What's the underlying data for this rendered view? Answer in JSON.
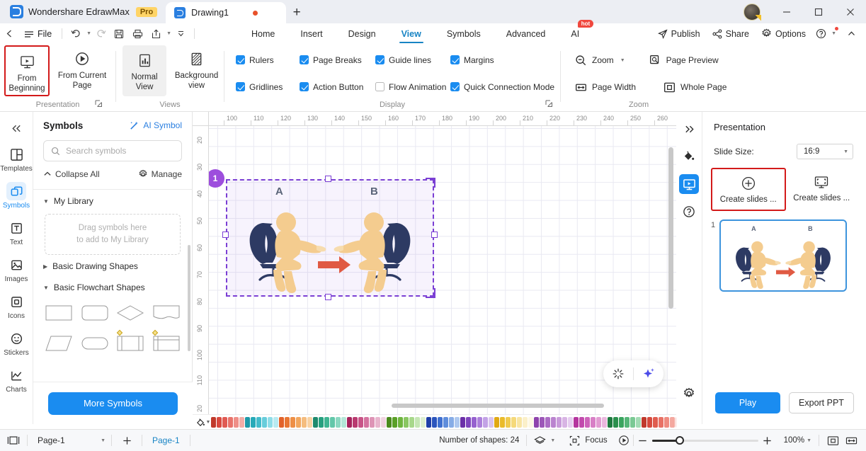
{
  "titlebar": {
    "brand": "Wondershare EdrawMax",
    "pro_badge": "Pro",
    "document_tab": "Drawing1",
    "new_tab_icon": "plus-icon",
    "minimize_icon": "minimize-icon",
    "maximize_icon": "maximize-icon",
    "close_icon": "close-icon"
  },
  "quick_access": {
    "back_icon": "chevron-left-icon",
    "file_label": "File",
    "undo_icon": "undo-icon",
    "redo_icon": "redo-icon",
    "save_icon": "save-icon",
    "print_icon": "print-icon",
    "export_icon": "export-icon",
    "more_icon": "chevron-down-icon"
  },
  "ribbon_tabs": [
    {
      "label": "Home",
      "active": false
    },
    {
      "label": "Insert",
      "active": false
    },
    {
      "label": "Design",
      "active": false
    },
    {
      "label": "View",
      "active": true
    },
    {
      "label": "Symbols",
      "active": false
    },
    {
      "label": "Advanced",
      "active": false
    },
    {
      "label": "AI",
      "active": false,
      "badge": "hot"
    }
  ],
  "menu_right": [
    {
      "label": "Publish",
      "icon": "send-icon"
    },
    {
      "label": "Share",
      "icon": "share-nodes-icon"
    },
    {
      "label": "Options",
      "icon": "gear-icon"
    },
    {
      "label": "",
      "icon": "help-circle-icon"
    },
    {
      "label": "",
      "icon": "chevron-up-icon"
    }
  ],
  "ribbon": {
    "presentation_group": {
      "label": "Presentation",
      "buttons": [
        {
          "label": "From Beginning",
          "icon": "present-screen-icon",
          "highlighted": true
        },
        {
          "label": "From Current Page",
          "icon": "play-circle-icon",
          "highlighted": false
        }
      ]
    },
    "views_group": {
      "label": "Views",
      "buttons": [
        {
          "label": "Normal View",
          "icon": "normal-view-icon",
          "selected": true
        },
        {
          "label": "Background view",
          "icon": "background-view-icon",
          "selected": false
        }
      ]
    },
    "display_group": {
      "label": "Display",
      "checkboxes": [
        {
          "label": "Rulers",
          "checked": true
        },
        {
          "label": "Page Breaks",
          "checked": true
        },
        {
          "label": "Guide lines",
          "checked": true
        },
        {
          "label": "Margins",
          "checked": true
        },
        {
          "label": "Gridlines",
          "checked": true
        },
        {
          "label": "Action Button",
          "checked": true
        },
        {
          "label": "Flow Animation",
          "checked": false
        },
        {
          "label": "Quick Connection Mode",
          "checked": true
        }
      ]
    },
    "zoom_group": {
      "label": "Zoom",
      "buttons": [
        {
          "label": "Zoom",
          "icon": "zoom-out-icon",
          "dropdown": true
        },
        {
          "label": "Page Preview",
          "icon": "page-preview-icon",
          "dropdown": false
        },
        {
          "label": "Page Width",
          "icon": "page-width-icon",
          "dropdown": false
        },
        {
          "label": "Whole Page",
          "icon": "whole-page-icon",
          "dropdown": false
        }
      ]
    }
  },
  "left_rail": {
    "collapse_icon": "double-chevron-left-icon",
    "items": [
      {
        "label": "Templates",
        "icon": "templates-icon",
        "active": false
      },
      {
        "label": "Symbols",
        "icon": "symbols-icon",
        "active": true
      },
      {
        "label": "Text",
        "icon": "text-icon",
        "active": false
      },
      {
        "label": "Images",
        "icon": "images-icon",
        "active": false
      },
      {
        "label": "Icons",
        "icon": "icons-icon",
        "active": false
      },
      {
        "label": "Stickers",
        "icon": "stickers-icon",
        "active": false
      },
      {
        "label": "Charts",
        "icon": "charts-icon",
        "active": false
      }
    ]
  },
  "symbols_panel": {
    "title": "Symbols",
    "ai_symbol": "AI Symbol",
    "ai_symbol_icon": "magic-wand-icon",
    "search_placeholder": "Search symbols",
    "search_value": "",
    "search_icon": "search-icon",
    "collapse_all": "Collapse All",
    "collapse_all_icon": "chevron-up-icon",
    "manage": "Manage",
    "manage_icon": "gear-icon",
    "sections": [
      {
        "label": "My Library",
        "expanded": true
      },
      {
        "label": "Basic Drawing Shapes",
        "expanded": false
      },
      {
        "label": "Basic Flowchart Shapes",
        "expanded": true
      }
    ],
    "dropzone_line1": "Drag symbols here",
    "dropzone_line2": "to add to My Library",
    "more_symbols": "More Symbols"
  },
  "canvas": {
    "h_ruler_ticks": [
      "100",
      "110",
      "120",
      "130",
      "140",
      "150",
      "160",
      "170",
      "180",
      "190",
      "200",
      "210",
      "220",
      "230",
      "240",
      "250",
      "260"
    ],
    "v_ruler_ticks": [
      "20",
      "30",
      "40",
      "50",
      "60",
      "70",
      "80",
      "90",
      "100",
      "110",
      "20"
    ],
    "shape_label_a": "A",
    "shape_label_b": "B",
    "selection_badge": "1",
    "float_buttons": [
      {
        "icon": "sparkle-burst-icon"
      },
      {
        "icon": "ai-sparkle-icon"
      }
    ]
  },
  "palette": {
    "fill_tool_icon": "fill-bucket-icon",
    "swatches_row1": [
      "#c0392b",
      "#d9493f",
      "#e05a52",
      "#e8736b",
      "#ef8f88",
      "#f2ada7",
      "#1d99a8",
      "#27aab8",
      "#43bccb",
      "#67cddb",
      "#8fdde8",
      "#b8eaf1",
      "#e2622a",
      "#e87634",
      "#ee8f45",
      "#f2a75e",
      "#f5bd7e",
      "#f8d2a3",
      "#1e8a6e",
      "#27a07f",
      "#3fb592",
      "#62c7a9",
      "#8bd8c1",
      "#b4e6d7",
      "#a6235c",
      "#b93a6f",
      "#c85487",
      "#d4739f",
      "#de94b6",
      "#e8b5cd",
      "#f0d2e0",
      "#4b8a1e",
      "#5aa027",
      "#6fb53f",
      "#8ac762",
      "#a8d88b",
      "#c5e6b4",
      "#ddefd0",
      "#1f3fa8",
      "#2b55bd",
      "#4070cf",
      "#5f8ddb",
      "#86ace6",
      "#aec8ef",
      "#6b2fa8",
      "#7f45bd",
      "#9661cf",
      "#ad80db",
      "#c3a2e6",
      "#d9c4ef",
      "#e0a915",
      "#eabb2a",
      "#f0cb4f",
      "#f5d97a",
      "#f8e5a3",
      "#fbf0c9",
      "#fdf8e4",
      "#8e44ad",
      "#9c57b8",
      "#ab6cc4",
      "#ba83cf",
      "#c99bda",
      "#d8b4e4",
      "#e6cdef",
      "#b5359e",
      "#c24aad",
      "#cd63ba",
      "#d87fc6",
      "#e29cd2",
      "#ebb8de",
      "#1f7a3f",
      "#2a8f4c",
      "#3aa45e",
      "#56b678",
      "#7ac994",
      "#a2dbb4",
      "#c0392b"
    ],
    "swatches_row2": [
      "#d64a3d",
      "#e05c4e",
      "#e87165",
      "#ef8b80",
      "#f4a89f",
      "#f7c2bb",
      "#1f4fa0",
      "#2a64b5",
      "#3c7dc8",
      "#5a97d6",
      "#7fb2e3",
      "#a5caee",
      "#8a3a12",
      "#a0481c",
      "#b55a2a",
      "#c77240",
      "#d68e61",
      "#e2a987",
      "#1780b5",
      "#2a93c4",
      "#44a8d3",
      "#66bde0",
      "#8ed1ea",
      "#b6e2f2",
      "#6b4a35",
      "#7d5a42",
      "#8f6b52",
      "#a07e67",
      "#b29382",
      "#c3a99c",
      "#e89b6d",
      "#ec9f72",
      "#9a9488",
      "#a8a296",
      "#c6c0b4",
      "#d4cec3",
      "#e2ddd4",
      "#f0ece6",
      "#111111",
      "#1c1c1c",
      "#2b2b2b",
      "#3b3b3b",
      "#4d4d4d",
      "#626262",
      "#7a7a7a",
      "#949494",
      "#adadad",
      "#c4c4c4",
      "#d8d8d8",
      "#e9e9e9",
      "#f5f5f5",
      "#ffffff"
    ]
  },
  "right_rail": {
    "collapse_icon": "double-chevron-right-icon",
    "items": [
      {
        "icon": "fill-style-icon",
        "active": false
      },
      {
        "icon": "presentation-icon",
        "active": true
      },
      {
        "icon": "help-circle-icon",
        "active": false
      }
    ],
    "gear_icon": "gear-icon"
  },
  "presentation_panel": {
    "title": "Presentation",
    "slide_size_label": "Slide Size:",
    "slide_size_value": "16:9",
    "slide_size_caret": "chevron-down-icon",
    "create_buttons": [
      {
        "label": "Create slides ...",
        "icon": "plus-circle-icon",
        "highlighted": true
      },
      {
        "label": "Create slides ...",
        "icon": "slide-frame-icon",
        "highlighted": false
      }
    ],
    "slides": [
      {
        "number": "1",
        "label_a": "A",
        "label_b": "B"
      }
    ],
    "play_label": "Play",
    "export_label": "Export PPT"
  },
  "status_bar": {
    "view_toggle_icon": "page-layout-icon",
    "page_select_value": "Page-1",
    "page_select_caret": "chevron-down-icon",
    "add_page_icon": "plus-icon",
    "active_page_tab": "Page-1",
    "shapes_count_label": "Number of shapes: 24",
    "layers_icon": "layers-icon",
    "focus_label": "Focus",
    "focus_icon": "focus-frame-icon",
    "play_icon": "play-circle-icon",
    "zoom_out_icon": "minus-icon",
    "zoom_in_icon": "plus-icon",
    "zoom_value": "100%",
    "zoom_caret": "chevron-down-icon",
    "fit_page_icon": "fit-page-icon",
    "fit_width_icon": "fit-width-icon"
  },
  "colors": {
    "accent_blue": "#1a8cf0",
    "tab_active": "#1884c4",
    "highlight_red": "#d31a1a",
    "selection_purple": "#7b3fd4",
    "badge_purple": "#9d4edd",
    "figure_navy": "#2d3a63",
    "figure_skin": "#f4cc8f",
    "arrow_red": "#e05a43",
    "pro_badge_bg": "#ffd466"
  }
}
